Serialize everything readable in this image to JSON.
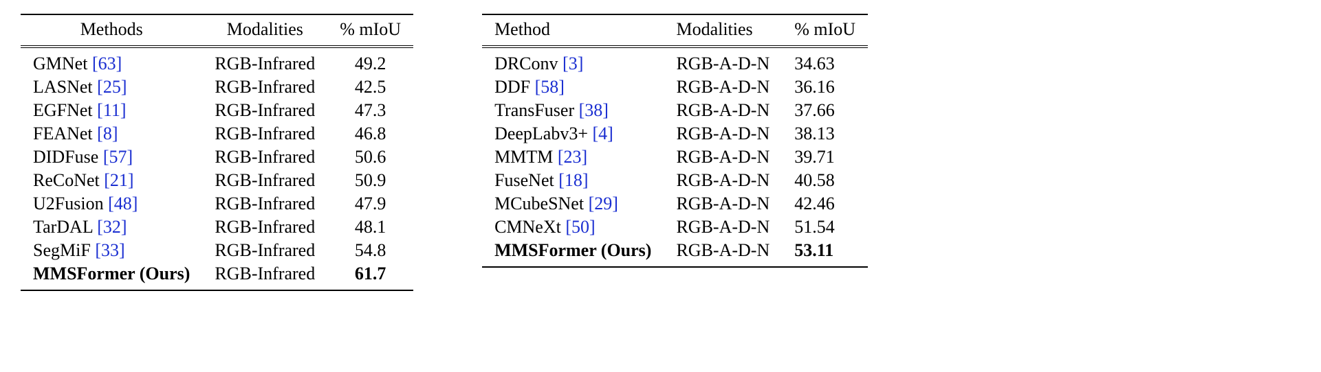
{
  "tables": [
    {
      "headers": {
        "methods": "Methods",
        "modalities": "Modalities",
        "miou": "% mIoU"
      },
      "rows": [
        {
          "method": "GMNet",
          "cite": "[63]",
          "modality": "RGB-Infrared",
          "miou": "49.2",
          "bold": false
        },
        {
          "method": "LASNet",
          "cite": "[25]",
          "modality": "RGB-Infrared",
          "miou": "42.5",
          "bold": false
        },
        {
          "method": "EGFNet",
          "cite": "[11]",
          "modality": "RGB-Infrared",
          "miou": "47.3",
          "bold": false
        },
        {
          "method": "FEANet",
          "cite": "[8]",
          "modality": "RGB-Infrared",
          "miou": "46.8",
          "bold": false
        },
        {
          "method": "DIDFuse",
          "cite": "[57]",
          "modality": "RGB-Infrared",
          "miou": "50.6",
          "bold": false
        },
        {
          "method": "ReCoNet",
          "cite": "[21]",
          "modality": "RGB-Infrared",
          "miou": "50.9",
          "bold": false
        },
        {
          "method": "U2Fusion",
          "cite": "[48]",
          "modality": "RGB-Infrared",
          "miou": "47.9",
          "bold": false
        },
        {
          "method": "TarDAL",
          "cite": "[32]",
          "modality": "RGB-Infrared",
          "miou": "48.1",
          "bold": false
        },
        {
          "method": "SegMiF",
          "cite": "[33]",
          "modality": "RGB-Infrared",
          "miou": "54.8",
          "bold": false
        },
        {
          "method": "MMSFormer (Ours)",
          "cite": "",
          "modality": "RGB-Infrared",
          "miou": "61.7",
          "bold": true
        }
      ]
    },
    {
      "headers": {
        "methods": "Method",
        "modalities": "Modalities",
        "miou": "% mIoU"
      },
      "rows": [
        {
          "method": "DRConv",
          "cite": "[3]",
          "modality": "RGB-A-D-N",
          "miou": "34.63",
          "bold": false
        },
        {
          "method": "DDF",
          "cite": "[58]",
          "modality": "RGB-A-D-N",
          "miou": "36.16",
          "bold": false
        },
        {
          "method": "TransFuser",
          "cite": "[38]",
          "modality": "RGB-A-D-N",
          "miou": "37.66",
          "bold": false
        },
        {
          "method": "DeepLabv3+",
          "cite": "[4]",
          "modality": "RGB-A-D-N",
          "miou": "38.13",
          "bold": false
        },
        {
          "method": "MMTM",
          "cite": "[23]",
          "modality": "RGB-A-D-N",
          "miou": "39.71",
          "bold": false
        },
        {
          "method": "FuseNet",
          "cite": "[18]",
          "modality": "RGB-A-D-N",
          "miou": "40.58",
          "bold": false
        },
        {
          "method": "MCubeSNet",
          "cite": "[29]",
          "modality": "RGB-A-D-N",
          "miou": "42.46",
          "bold": false
        },
        {
          "method": "CMNeXt",
          "cite": "[50]",
          "modality": "RGB-A-D-N",
          "miou": "51.54",
          "bold": false
        },
        {
          "method": "MMSFormer (Ours)",
          "cite": "",
          "modality": "RGB-A-D-N",
          "miou": "53.11",
          "bold": true
        }
      ]
    }
  ],
  "chart_data": [
    {
      "type": "table",
      "title": "",
      "columns": [
        "Methods",
        "Modalities",
        "% mIoU"
      ],
      "rows": [
        [
          "GMNet [63]",
          "RGB-Infrared",
          49.2
        ],
        [
          "LASNet [25]",
          "RGB-Infrared",
          42.5
        ],
        [
          "EGFNet [11]",
          "RGB-Infrared",
          47.3
        ],
        [
          "FEANet [8]",
          "RGB-Infrared",
          46.8
        ],
        [
          "DIDFuse [57]",
          "RGB-Infrared",
          50.6
        ],
        [
          "ReCoNet [21]",
          "RGB-Infrared",
          50.9
        ],
        [
          "U2Fusion [48]",
          "RGB-Infrared",
          47.9
        ],
        [
          "TarDAL [32]",
          "RGB-Infrared",
          48.1
        ],
        [
          "SegMiF [33]",
          "RGB-Infrared",
          54.8
        ],
        [
          "MMSFormer (Ours)",
          "RGB-Infrared",
          61.7
        ]
      ]
    },
    {
      "type": "table",
      "title": "",
      "columns": [
        "Method",
        "Modalities",
        "% mIoU"
      ],
      "rows": [
        [
          "DRConv [3]",
          "RGB-A-D-N",
          34.63
        ],
        [
          "DDF [58]",
          "RGB-A-D-N",
          36.16
        ],
        [
          "TransFuser [38]",
          "RGB-A-D-N",
          37.66
        ],
        [
          "DeepLabv3+ [4]",
          "RGB-A-D-N",
          38.13
        ],
        [
          "MMTM [23]",
          "RGB-A-D-N",
          39.71
        ],
        [
          "FuseNet [18]",
          "RGB-A-D-N",
          40.58
        ],
        [
          "MCubeSNet [29]",
          "RGB-A-D-N",
          42.46
        ],
        [
          "CMNeXt [50]",
          "RGB-A-D-N",
          51.54
        ],
        [
          "MMSFormer (Ours)",
          "RGB-A-D-N",
          53.11
        ]
      ]
    }
  ]
}
